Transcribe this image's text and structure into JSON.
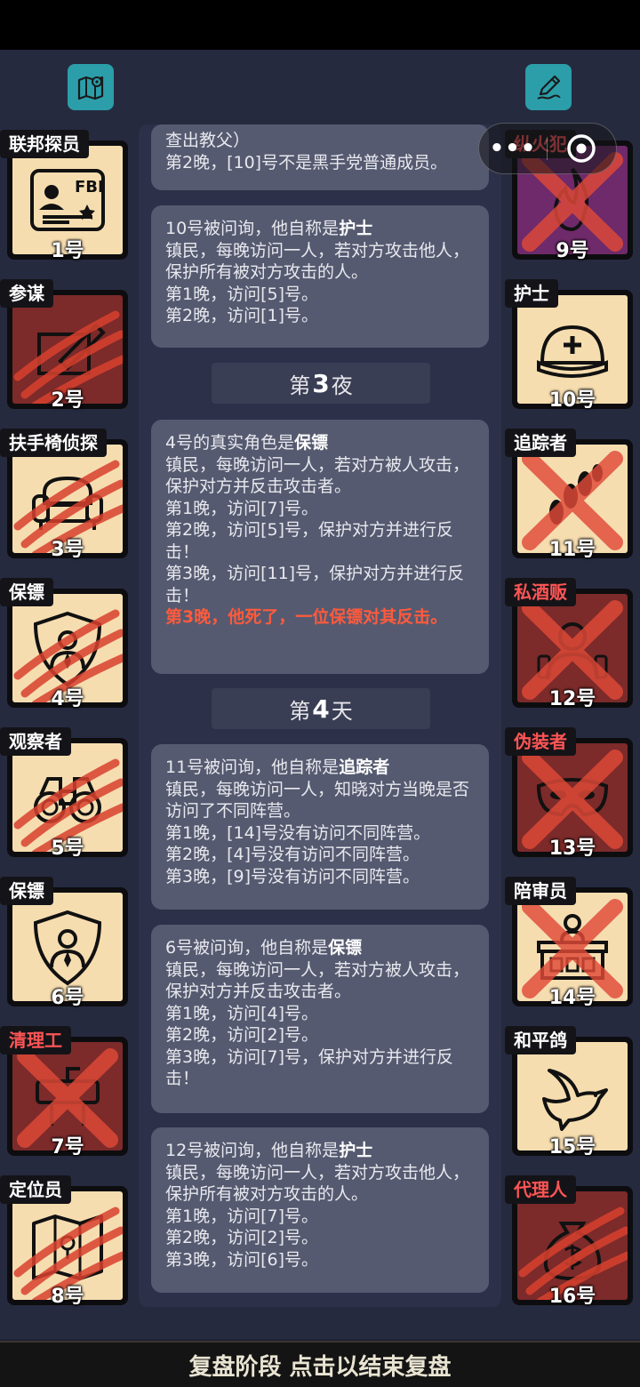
{
  "header": {
    "left_icon": "map-pin-icon",
    "right_icon": "pen-icon"
  },
  "capsule": {
    "more": "•••",
    "close_icon": "target-icon"
  },
  "left_players": [
    {
      "role": "联邦探员",
      "num": "1号",
      "state": "alive",
      "icon": "fbi-badge-icon"
    },
    {
      "role": "参谋",
      "num": "2号",
      "state": "dead_claw",
      "icon": "pen-paper-icon"
    },
    {
      "role": "扶手椅侦探",
      "num": "3号",
      "state": "alive_claw",
      "icon": "armchair-icon"
    },
    {
      "role": "保镖",
      "num": "4号",
      "state": "alive_claw",
      "icon": "shield-person-icon"
    },
    {
      "role": "观察者",
      "num": "5号",
      "state": "alive_claw",
      "icon": "binoculars-icon"
    },
    {
      "role": "保镖",
      "num": "6号",
      "state": "alive",
      "icon": "shield-person-icon"
    },
    {
      "role": "清理工",
      "num": "7号",
      "state": "dead_x",
      "role_color": "red",
      "icon": "sink-icon"
    },
    {
      "role": "定位员",
      "num": "8号",
      "state": "alive_claw",
      "icon": "map-icon"
    }
  ],
  "right_players": [
    {
      "role": "纵火犯",
      "num": "9号",
      "state": "purple_x",
      "role_color": "red",
      "icon": "fire-icon"
    },
    {
      "role": "护士",
      "num": "10号",
      "state": "alive",
      "icon": "nurse-cap-icon"
    },
    {
      "role": "追踪者",
      "num": "11号",
      "state": "alive_x",
      "icon": "footprints-icon"
    },
    {
      "role": "私酒贩",
      "num": "12号",
      "state": "dead_x",
      "role_color": "red",
      "icon": "bootlegger-icon"
    },
    {
      "role": "伪装者",
      "num": "13号",
      "state": "dead_x",
      "role_color": "red",
      "icon": "mask-icon"
    },
    {
      "role": "陪审员",
      "num": "14号",
      "state": "alive_x",
      "icon": "jury-icon"
    },
    {
      "role": "和平鸽",
      "num": "15号",
      "state": "alive",
      "icon": "dove-icon"
    },
    {
      "role": "代理人",
      "num": "16号",
      "state": "dead_claw",
      "role_color": "red",
      "icon": "money-bag-icon"
    }
  ],
  "log": {
    "msg1": {
      "line1": "查出教父）",
      "line2": "第2晚，[10]号不是黑手党普通成员。"
    },
    "msg2": {
      "prefix": "10号被问询，他自称是",
      "role": "护士",
      "desc": "镇民，每晚访问一人，若对方攻击他人，保护所有被对方攻击的人。",
      "n1": "第1晚，访问[5]号。",
      "n2": "第2晚，访问[1]号。"
    },
    "phase3": {
      "pre": "第",
      "num": "3",
      "post": "夜"
    },
    "msg3": {
      "prefix": "4号的真实角色是",
      "role": "保镖",
      "desc": "镇民，每晚访问一人，若对方被人攻击，保护对方并反击攻击者。",
      "n1": "第1晚，访问[7]号。",
      "n2": "第2晚，访问[5]号，保护对方并进行反击！",
      "n3": "第3晚，访问[11]号，保护对方并进行反击！",
      "death": "第3晚，他死了，一位保镖对其反击。"
    },
    "phase4": {
      "pre": "第",
      "num": "4",
      "post": "天"
    },
    "msg4": {
      "prefix": "11号被问询，他自称是",
      "role": "追踪者",
      "desc": "镇民，每晚访问一人，知晓对方当晚是否访问了不同阵营。",
      "n1": "第1晚，[14]号没有访问不同阵营。",
      "n2": "第2晚，[4]号没有访问不同阵营。",
      "n3": "第3晚，[9]号没有访问不同阵营。"
    },
    "msg5": {
      "prefix": "6号被问询，他自称是",
      "role": "保镖",
      "desc": "镇民，每晚访问一人，若对方被人攻击，保护对方并反击攻击者。",
      "n1": "第1晚，访问[4]号。",
      "n2": "第2晚，访问[2]号。",
      "n3": "第3晚，访问[7]号，保护对方并进行反击！"
    },
    "msg6": {
      "prefix": "12号被问询，他自称是",
      "role": "护士",
      "desc": "镇民，每晚访问一人，若对方攻击他人，保护所有被对方攻击的人。",
      "n1": "第1晚，访问[7]号。",
      "n2": "第2晚，访问[2]号。",
      "n3": "第3晚，访问[6]号。"
    }
  },
  "footer": {
    "text": "复盘阶段 点击以结束复盘"
  },
  "colors": {
    "card_alive": "#f6ddb0",
    "card_dead": "#7c2a2a",
    "card_purple": "#6e2a6a",
    "accent_red": "#ff5a3c",
    "teal": "#2b9eaa"
  }
}
